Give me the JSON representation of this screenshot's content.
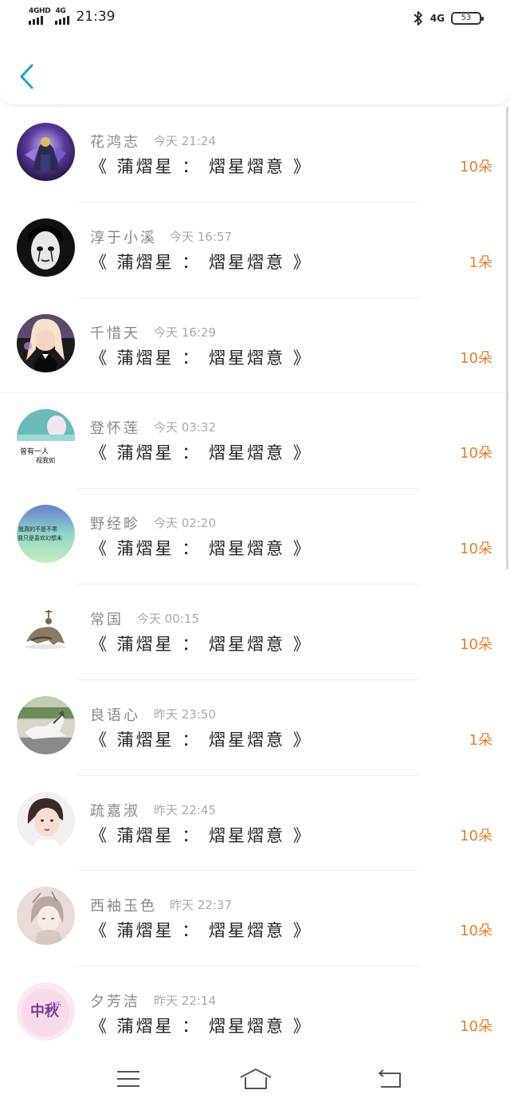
{
  "status_bar": {
    "net1": "4GHD",
    "net2": "4G",
    "time": "21:39",
    "right_net": "4G",
    "battery": "53",
    "icons": [
      "signal-icon",
      "bluetooth-icon",
      "battery-icon"
    ]
  },
  "header": {
    "back_icon": "chevron-left-icon"
  },
  "colors": {
    "accent": "#2b9be8",
    "count": "#e07f30",
    "name": "#888888",
    "time": "#aaaaaa"
  },
  "messages": [
    {
      "name": "花鸿志",
      "time": "今天 21:24",
      "title": "《 蒲熠星 ： 熠星熠意 》",
      "count": "10朵"
    },
    {
      "name": "淳于小溪",
      "time": "今天 16:57",
      "title": "《 蒲熠星 ： 熠星熠意 》",
      "count": "1朵"
    },
    {
      "name": "千惜天",
      "time": "今天 16:29",
      "title": "《 蒲熠星 ： 熠星熠意 》",
      "count": "10朵"
    },
    {
      "name": "登怀莲",
      "time": "今天 03:32",
      "title": "《 蒲熠星 ： 熠星熠意 》",
      "count": "10朵",
      "avatar_text": [
        "曾有一人",
        "视我如"
      ]
    },
    {
      "name": "野经畛",
      "time": "今天 02:20",
      "title": "《 蒲熠星 ： 熠星熠意 》",
      "count": "10朵",
      "avatar_text": [
        "我真的不是不乖",
        "我只是喜欢幻想未"
      ]
    },
    {
      "name": "常国",
      "time": "今天 00:15",
      "title": "《 蒲熠星 ： 熠星熠意 》",
      "count": "10朵"
    },
    {
      "name": "良语心",
      "time": "昨天 23:50",
      "title": "《 蒲熠星 ： 熠星熠意 》",
      "count": "1朵"
    },
    {
      "name": "疏嘉淑",
      "time": "昨天 22:45",
      "title": "《 蒲熠星 ： 熠星熠意 》",
      "count": "10朵"
    },
    {
      "name": "西袖玉色",
      "time": "昨天 22:37",
      "title": "《 蒲熠星 ： 熠星熠意 》",
      "count": "10朵"
    },
    {
      "name": "夕芳洁",
      "time": "昨天 22:14",
      "title": "《 蒲熠星 ： 熠星熠意 》",
      "count": "10朵",
      "avatar_text": [
        "中秋",
        "快乐"
      ]
    }
  ],
  "nav_bar": {
    "icons": [
      "menu-icon",
      "home-icon",
      "back-icon"
    ]
  }
}
